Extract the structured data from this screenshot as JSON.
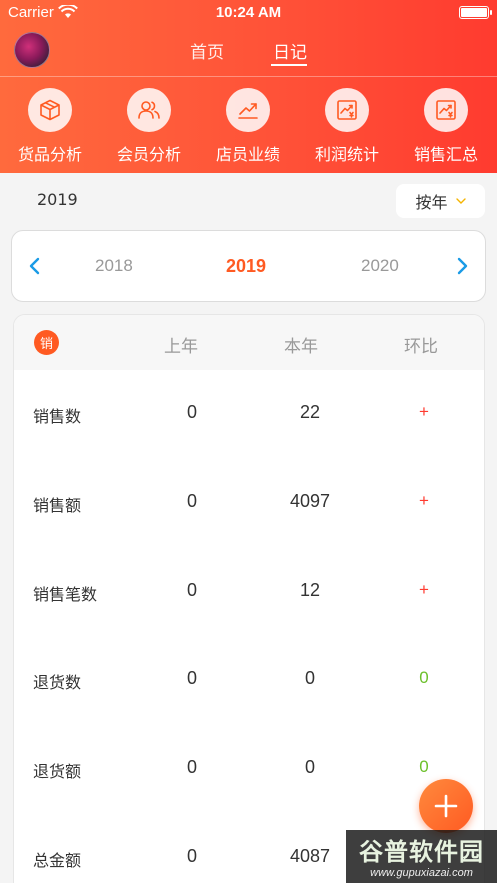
{
  "status_bar": {
    "carrier": "Carrier",
    "time": "10:24 AM"
  },
  "nav": {
    "tabs": [
      {
        "label": "首页"
      },
      {
        "label": "日记"
      }
    ],
    "active_tab": "日记"
  },
  "functions": [
    {
      "label": "货品分析",
      "icon": "box-icon"
    },
    {
      "label": "会员分析",
      "icon": "members-icon"
    },
    {
      "label": "店员业绩",
      "icon": "trend-chart-icon"
    },
    {
      "label": "利润统计",
      "icon": "profit-chart-icon"
    },
    {
      "label": "销售汇总",
      "icon": "sales-summary-icon"
    }
  ],
  "filter": {
    "year": "2019",
    "period_label": "按年"
  },
  "year_picker": {
    "prev": "2018",
    "current": "2019",
    "next": "2020"
  },
  "table": {
    "badge": "销",
    "headers": {
      "last_year": "上年",
      "this_year": "本年",
      "ratio": "环比"
    },
    "rows": [
      {
        "label": "销售数",
        "last": "0",
        "this": "22",
        "ratio": "+"
      },
      {
        "label": "销售额",
        "last": "0",
        "this": "4097",
        "ratio": "+"
      },
      {
        "label": "销售笔数",
        "last": "0",
        "this": "12",
        "ratio": "+"
      },
      {
        "label": "退货数",
        "last": "0",
        "this": "0",
        "ratio": "0"
      },
      {
        "label": "退货额",
        "last": "0",
        "this": "0",
        "ratio": "0"
      },
      {
        "label": "总金额",
        "last": "0",
        "this": "4087",
        "ratio": ""
      }
    ]
  },
  "watermark": {
    "title": "谷普软件园",
    "url": "www.gupuxiazai.com"
  },
  "colors": {
    "accent": "#ff5a22",
    "up": "#ff3b30",
    "flat": "#6cc02b",
    "header_start": "#ff6a3d",
    "header_end": "#ff3b2f"
  }
}
